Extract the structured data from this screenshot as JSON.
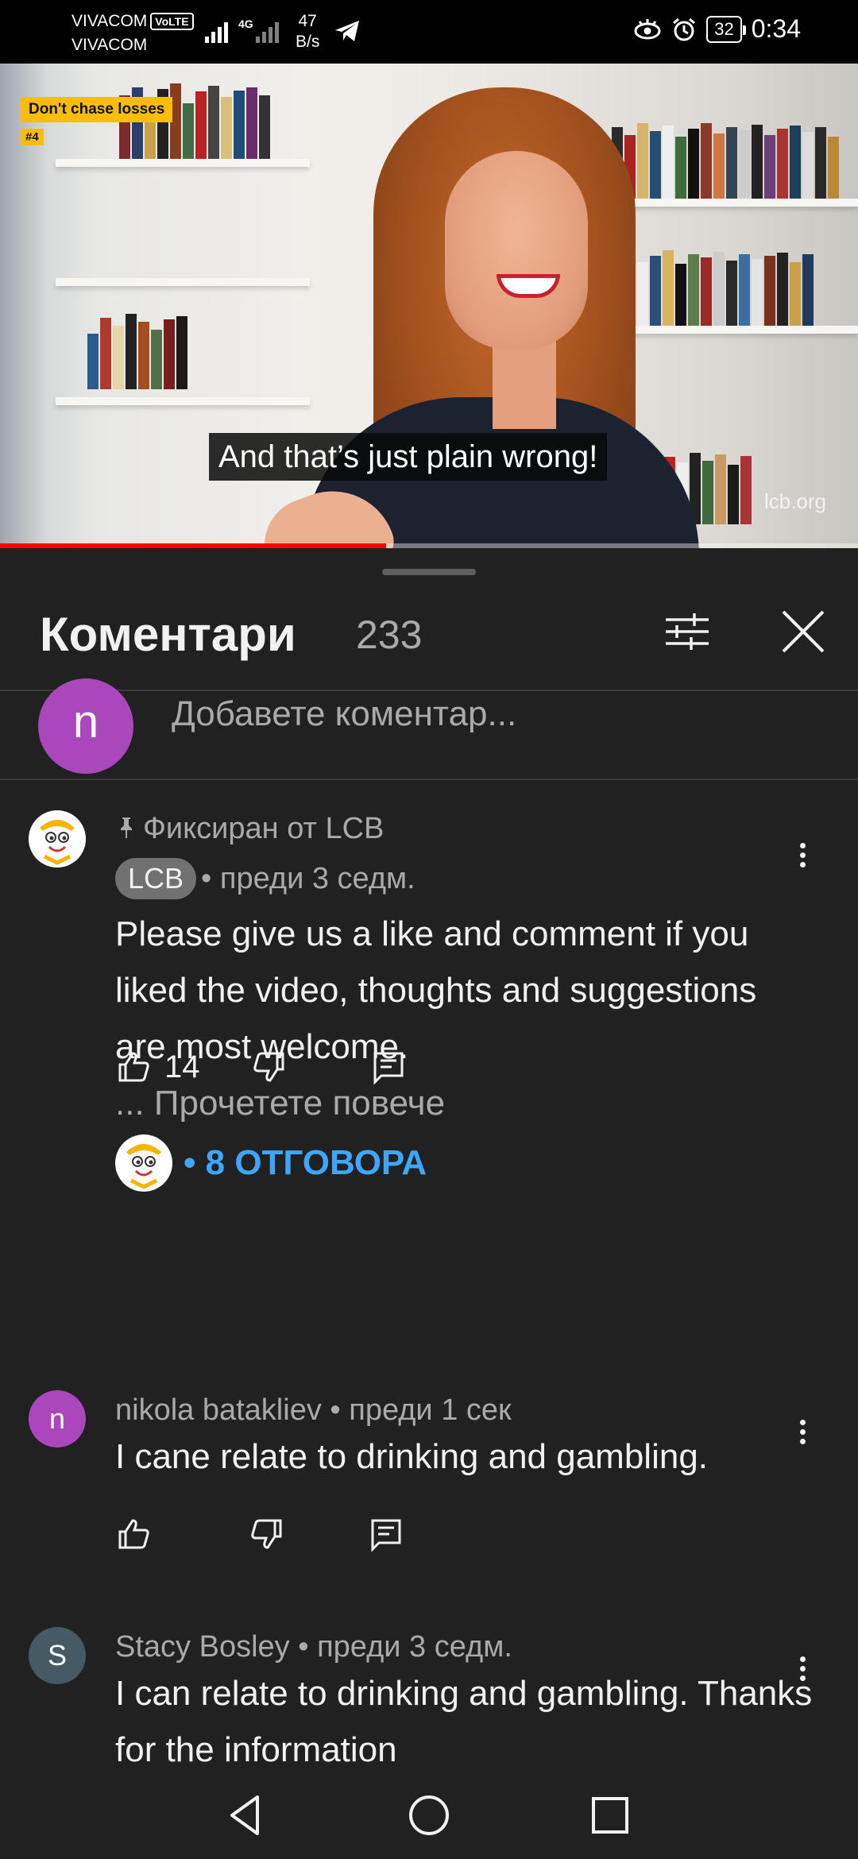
{
  "status_bar": {
    "carrier_1": "VIVACOM",
    "volte": "VoLTE",
    "carrier_2": "VIVACOM",
    "network": "4G",
    "speed_value": "47",
    "speed_unit": "B/s",
    "battery": "32",
    "time": "0:34"
  },
  "video": {
    "tag": "Don't chase losses",
    "tag_number": "#4",
    "caption": "And that’s just plain wrong!",
    "watermark": "lcb.org",
    "progress_fraction": 0.45
  },
  "comments_panel": {
    "title": "Коментари",
    "count": "233",
    "add_comment_avatar": "n",
    "add_comment_placeholder": "Добавете коментар..."
  },
  "comments": [
    {
      "pinned_label": "Фиксиран от LCB",
      "author": "LCB",
      "time": "• преди 3 седм.",
      "text": "Please give us a like and comment if you liked the video, thoughts and suggestions are most welcome.",
      "read_more": "... Прочетете повече",
      "likes": "14",
      "replies_label": "• 8 ОТГОВОРА"
    },
    {
      "avatar_letter": "n",
      "author_time": "nikola batakliev • преди 1 сек",
      "text": "I cane relate to drinking and gambling."
    },
    {
      "avatar_letter": "S",
      "author_time": "Stacy Bosley • преди 3 седм.",
      "text": "I can relate to drinking and gambling. Thanks for the information"
    }
  ],
  "colors": {
    "background": "#212121",
    "accent_blue": "#3ea6ff",
    "avatar_purple": "#ab47bc",
    "avatar_slate": "#455a64",
    "progress_red": "#ff0000"
  }
}
